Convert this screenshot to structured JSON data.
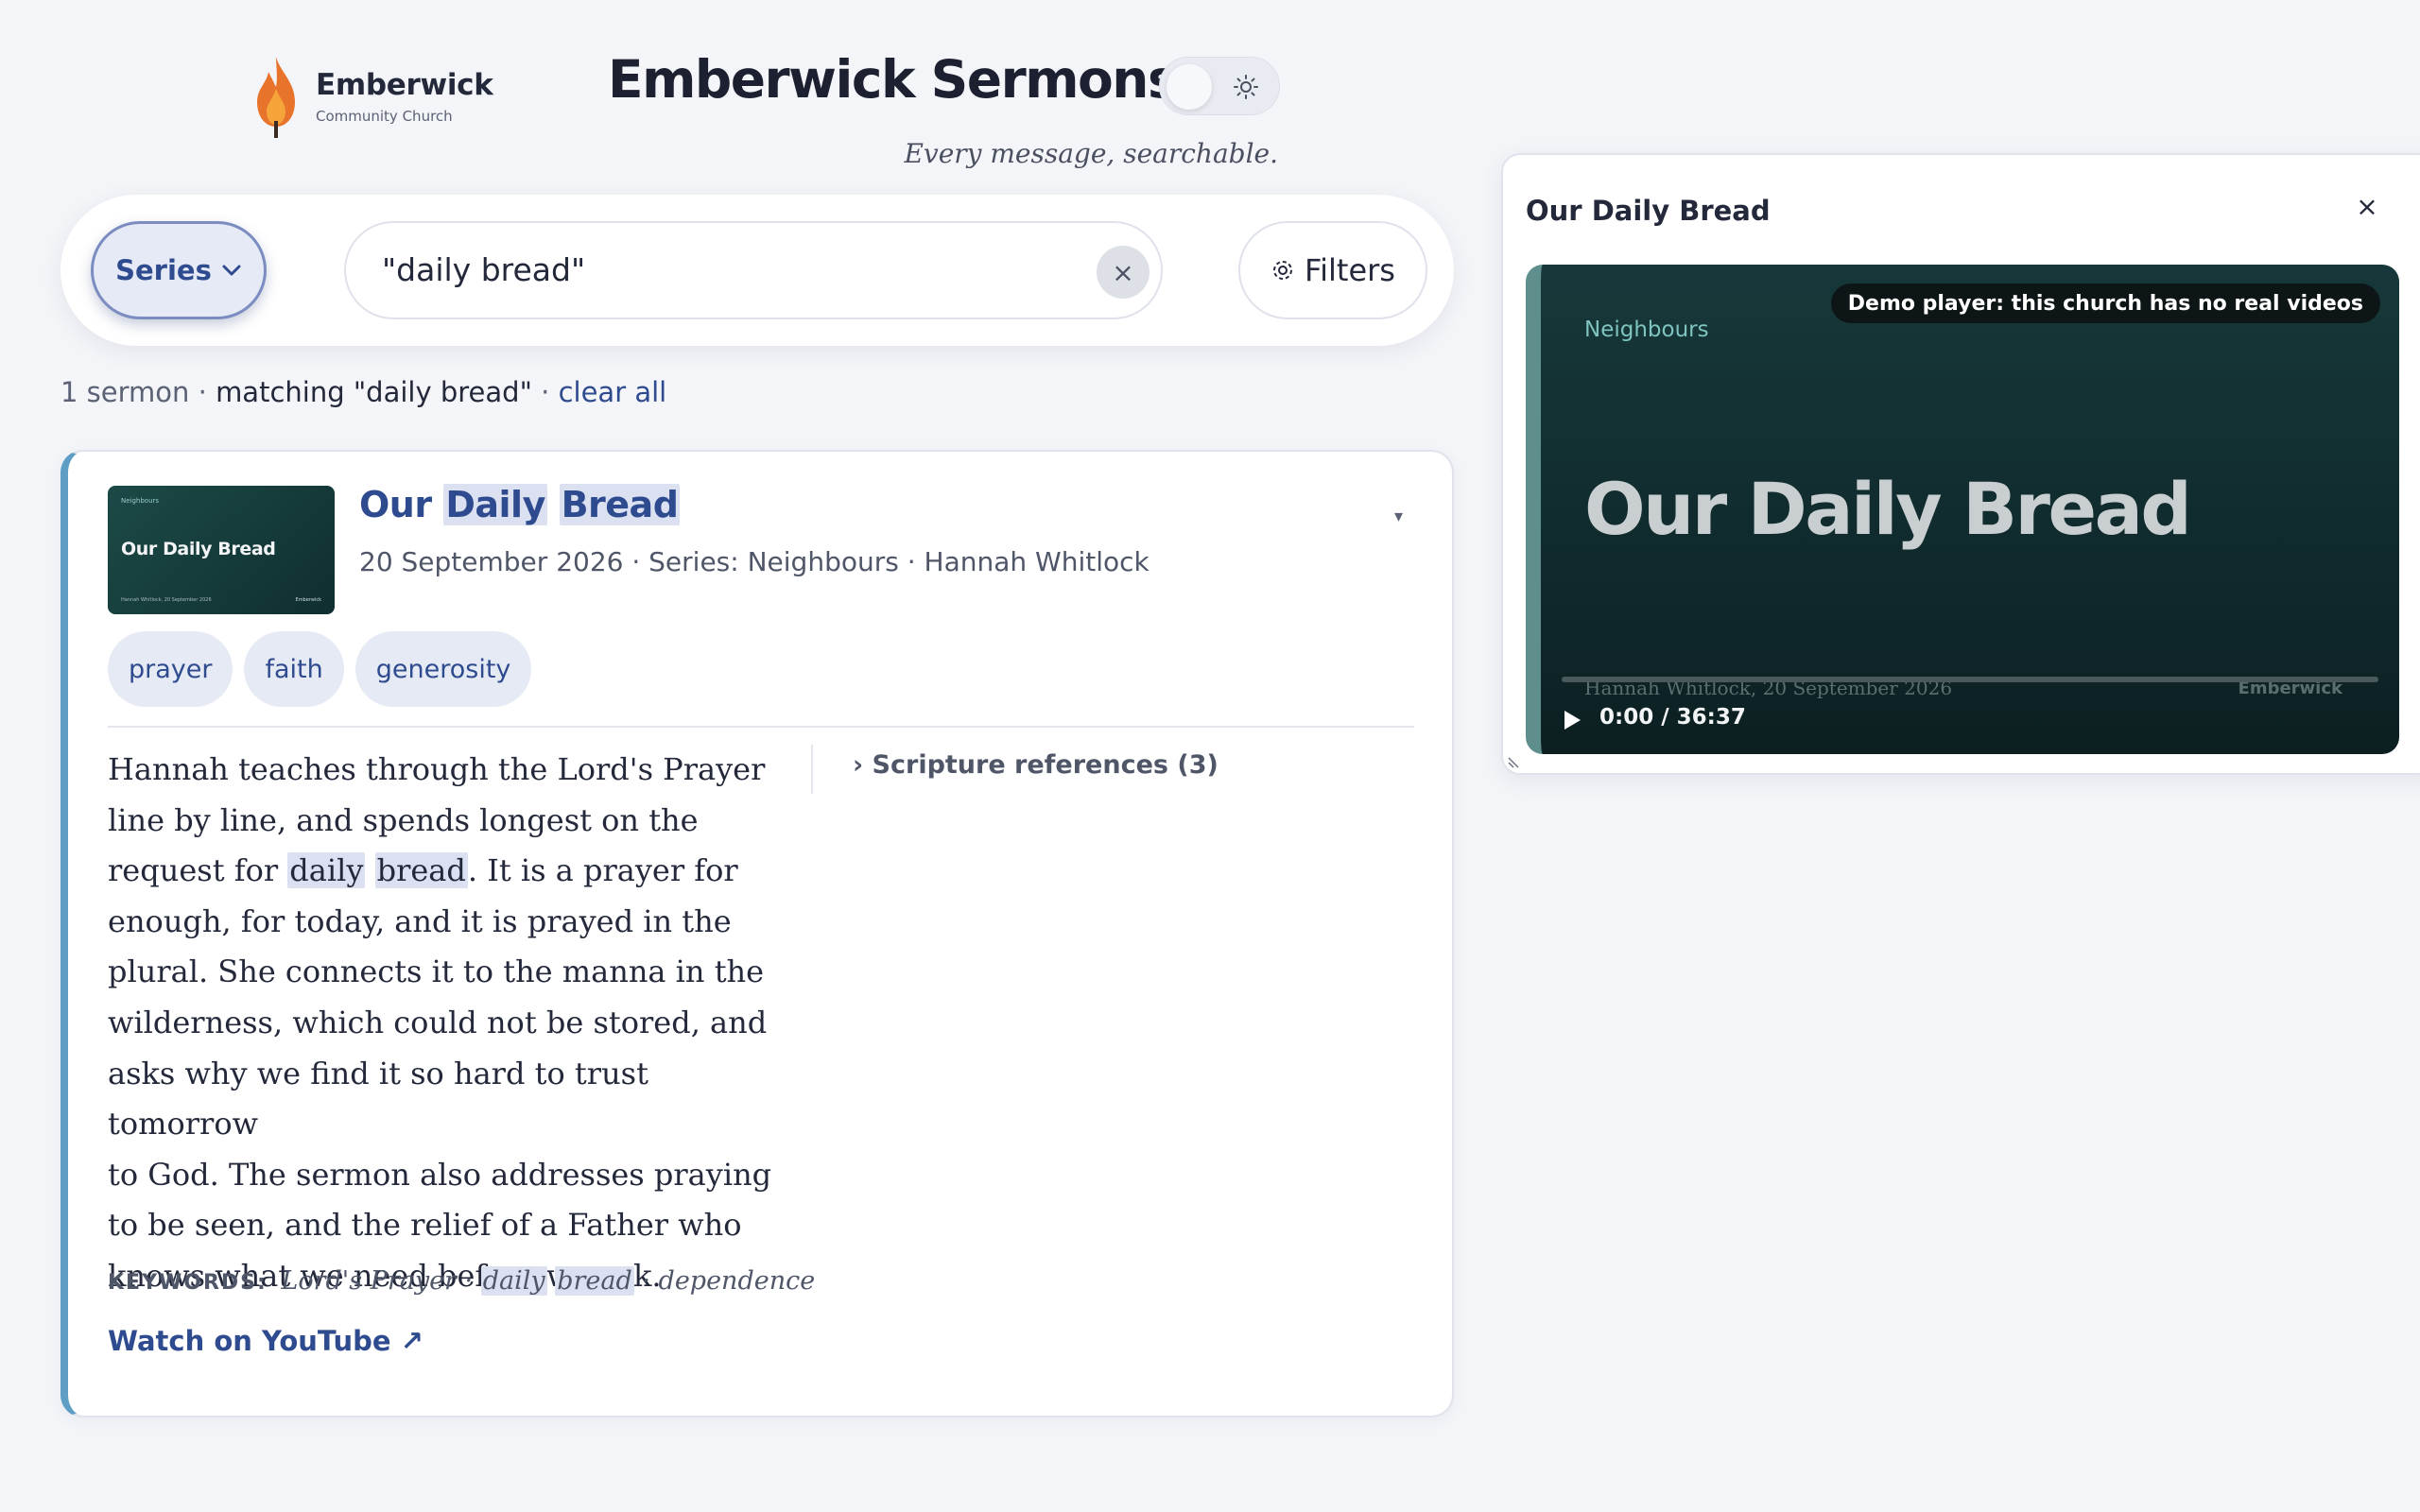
{
  "brand": {
    "name": "Emberwick",
    "subtitle": "Community Church",
    "flame_color": "#e8732a"
  },
  "header": {
    "title": "Emberwick Sermons",
    "tagline": "Every message, searchable."
  },
  "search": {
    "series_label": "Series",
    "query": "\"daily bread\"",
    "clear_glyph": "×",
    "filters_label": "Filters"
  },
  "summary": {
    "count": "1 sermon",
    "sep1": " · ",
    "matching": "matching \"daily bread\"",
    "sep2": " · ",
    "clear_all": "clear all"
  },
  "result": {
    "title_parts": [
      "Our ",
      "Daily",
      " ",
      "Bread"
    ],
    "date": "20 September 2026",
    "series": "Series: Neighbours",
    "speaker": "Hannah Whitlock",
    "meta_sep": " · ",
    "caret": "▾",
    "thumbnail": {
      "series": "Neighbours",
      "title": "Our Daily Bread",
      "footer": "Hannah Whitlock, 20 September 2026",
      "brand": "Emberwick"
    },
    "tags": [
      "prayer",
      "faith",
      "generosity"
    ],
    "description_lines": [
      [
        "Hannah teaches through the Lord's Prayer"
      ],
      [
        "line by line, and spends longest on the"
      ],
      [
        "request for ",
        {
          "hl": "daily"
        },
        " ",
        {
          "hl": "bread"
        },
        ". It is a prayer for"
      ],
      [
        "enough, for today, and it is prayed in the"
      ],
      [
        "plural. She connects it to the manna in the"
      ],
      [
        "wilderness, which could not be stored, and"
      ],
      [
        "asks why we find it so hard to trust tomorrow"
      ],
      [
        "to God. The sermon also addresses praying"
      ],
      [
        "to be seen, and the relief of a Father who"
      ],
      [
        "knows what we need before we ask."
      ]
    ],
    "scripture_label": "Scripture references (3)",
    "keywords_label": "KEYWORDS:",
    "keywords": {
      "k1": "Lord's Prayer",
      "sep": " · ",
      "k2": "daily",
      "k3": "bread",
      "k4": "dependence"
    },
    "watch_label": "Watch on YouTube ↗"
  },
  "player": {
    "title": "Our Daily Bread",
    "close_glyph": "×",
    "badge": "Demo player: this church has no real videos",
    "series": "Neighbours",
    "video_title": "Our Daily Bread",
    "footer": "Hannah Whitlock, 20 September 2026",
    "brand": "Emberwick",
    "time": "0:00 / 36:37",
    "progress": 0
  },
  "colors": {
    "accent": "#2f4b8f",
    "highlight": "#dbe1f1",
    "card_border": "#5f9ec4",
    "background": "#f4f5f9"
  },
  "icons": {
    "logo": "flame-icon",
    "theme": "sun-icon",
    "series_dropdown": "chevron-down-icon",
    "filters": "gear-icon",
    "scripture": "chevron-right-icon",
    "play": "play-icon",
    "close": "close-icon"
  }
}
